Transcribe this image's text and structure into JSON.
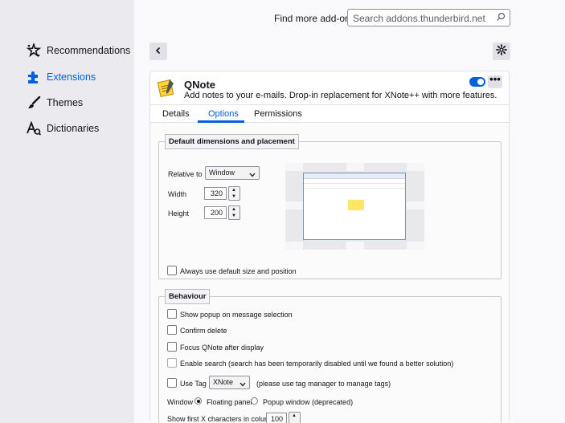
{
  "sidebar": {
    "items": [
      {
        "label": "Recommendations",
        "icon": "recommendations-icon"
      },
      {
        "label": "Extensions",
        "icon": "puzzle-icon",
        "active": true
      },
      {
        "label": "Themes",
        "icon": "brush-icon"
      },
      {
        "label": "Dictionaries",
        "icon": "dictionary-icon"
      }
    ]
  },
  "header": {
    "find_more": "Find more add-ons",
    "search_placeholder": "Search addons.thunderbird.net"
  },
  "addon": {
    "name": "QNote",
    "description": "Add notes to your e-mails. Drop-in replacement for XNote++ with more features.",
    "enabled": true,
    "more": "•••"
  },
  "tabs": [
    {
      "label": "Details"
    },
    {
      "label": "Options",
      "active": true
    },
    {
      "label": "Permissions"
    }
  ],
  "options": {
    "dimensions": {
      "legend": "Default dimensions and placement",
      "relative_label": "Relative to",
      "relative_value": "Window",
      "width_label": "Width",
      "width_value": "320",
      "height_label": "Height",
      "height_value": "200",
      "always_default": "Always use default size and position"
    },
    "behaviour": {
      "legend": "Behaviour",
      "show_popup": "Show popup on message selection",
      "confirm_delete": "Confirm delete",
      "focus_after": "Focus QNote after display",
      "enable_search": "Enable search (search has been temporarily disabled until we found a better solution)",
      "use_tag": "Use Tag",
      "tag_value": "XNote",
      "tag_note": "(please use tag manager to manage tags)",
      "window_label": "Window",
      "floating_panel": "Floating panel",
      "popup_window": "Popup window (deprecated)",
      "show_first": "Show first X characters in column",
      "show_first_value": "100"
    }
  },
  "colors": {
    "accent": "#0061e0",
    "sidebar_bg": "#ebebef"
  }
}
